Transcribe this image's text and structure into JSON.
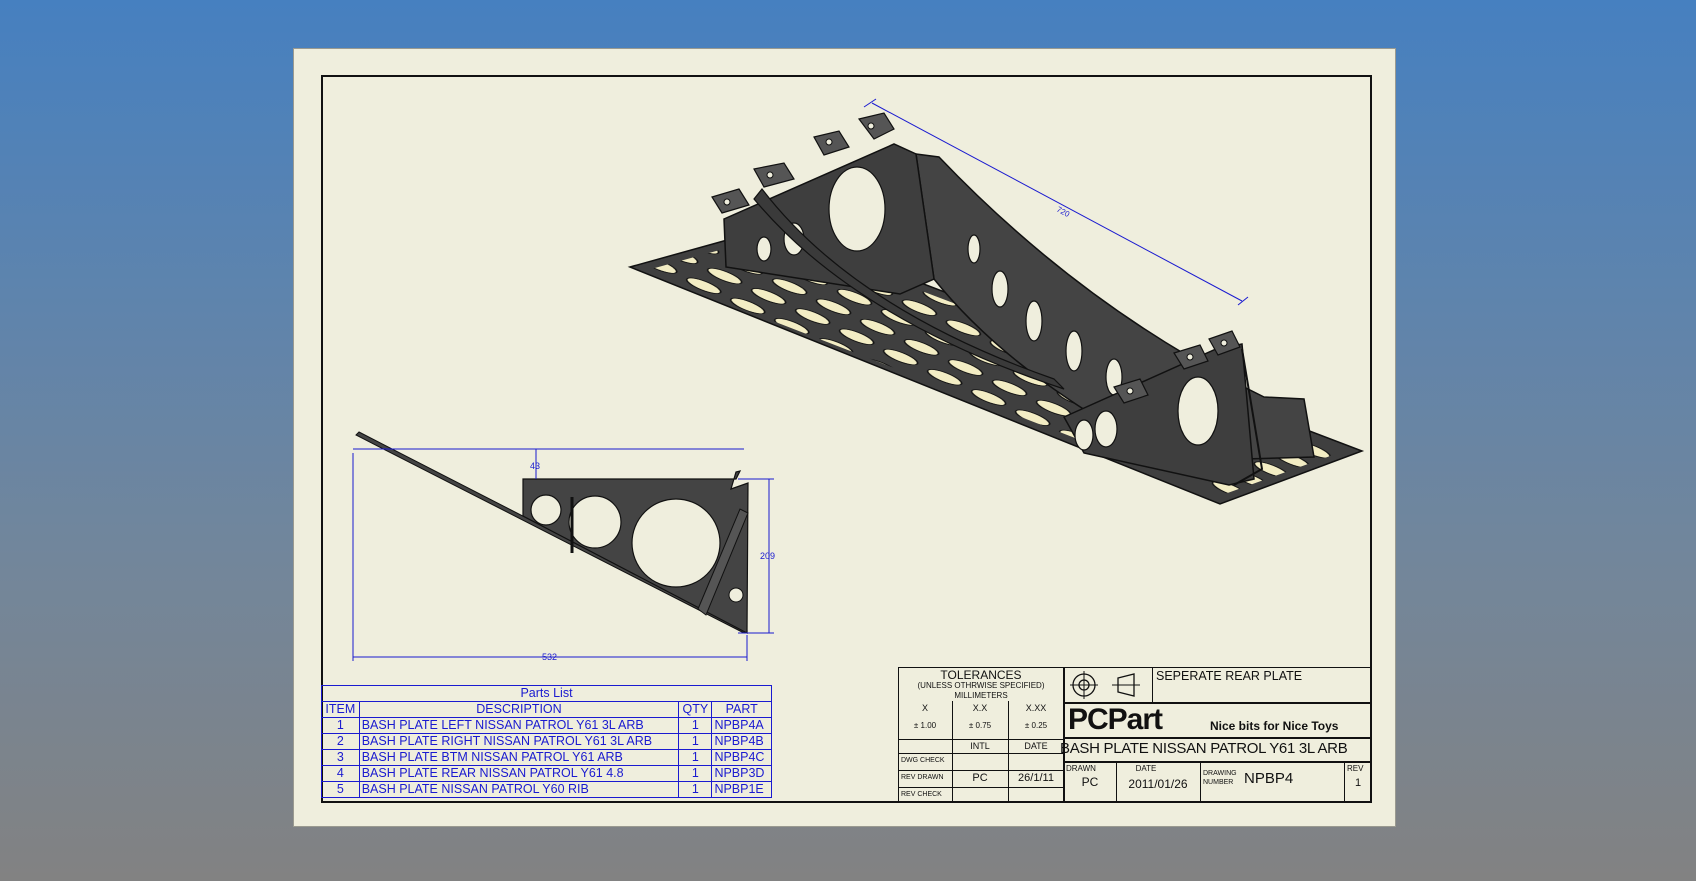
{
  "drawing": {
    "dimensions": {
      "length": "720",
      "offset": "43",
      "height": "209",
      "width": "532"
    }
  },
  "parts_list": {
    "caption": "Parts List",
    "headers": [
      "ITEM",
      "DESCRIPTION",
      "QTY",
      "PART"
    ],
    "rows": [
      [
        "1",
        "BASH PLATE LEFT NISSAN PATROL Y61 3L ARB",
        "1",
        "NPBP4A"
      ],
      [
        "2",
        "BASH PLATE RIGHT NISSAN PATROL Y61 3L ARB",
        "1",
        "NPBP4B"
      ],
      [
        "3",
        "BASH PLATE BTM NISSAN PATROL Y61 ARB",
        "1",
        "NPBP4C"
      ],
      [
        "4",
        "BASH PLATE REAR NISSAN PATROL Y61 4.8",
        "1",
        "NPBP3D"
      ],
      [
        "5",
        "BASH PLATE NISSAN PATROL Y60 RIB",
        "1",
        "NPBP1E"
      ]
    ]
  },
  "title_block": {
    "tolerances_title": "TOLERANCES",
    "tolerances_sub": "(UNLESS OTHRWISE SPECIFIED)",
    "tolerances_unit": "MILLIMETERS",
    "tol_x_label": "X",
    "tol_x_value": "± 1.00",
    "tol_xx_label": "X.X",
    "tol_xx_value": "± 0.75",
    "tol_xxx_label": "X.XX",
    "tol_xxx_value": "± 0.25",
    "col_intl": "INTL",
    "col_date": "DATE",
    "dwg_check": "DWG CHECK",
    "rev_drawn": "REV DRAWN",
    "rev_drawn_intl": "PC",
    "rev_drawn_date": "26/1/11",
    "rev_check": "REV CHECK",
    "note": "SEPERATE REAR PLATE",
    "company": "PCPart",
    "slogan": "Nice bits for Nice Toys",
    "title": "BASH PLATE NISSAN PATROL Y61 3L ARB",
    "drawn_label": "DRAWN",
    "drawn_value": "PC",
    "date_label": "DATE",
    "date_value": "2011/01/26",
    "drawing_number_label_1": "DRAWING",
    "drawing_number_label_2": "NUMBER",
    "drawing_number": "NPBP4",
    "rev_label": "REV",
    "rev_value": "1"
  },
  "colors": {
    "dimension": "#1a1ad0",
    "paper": "#efeedd",
    "part": "#444444"
  }
}
